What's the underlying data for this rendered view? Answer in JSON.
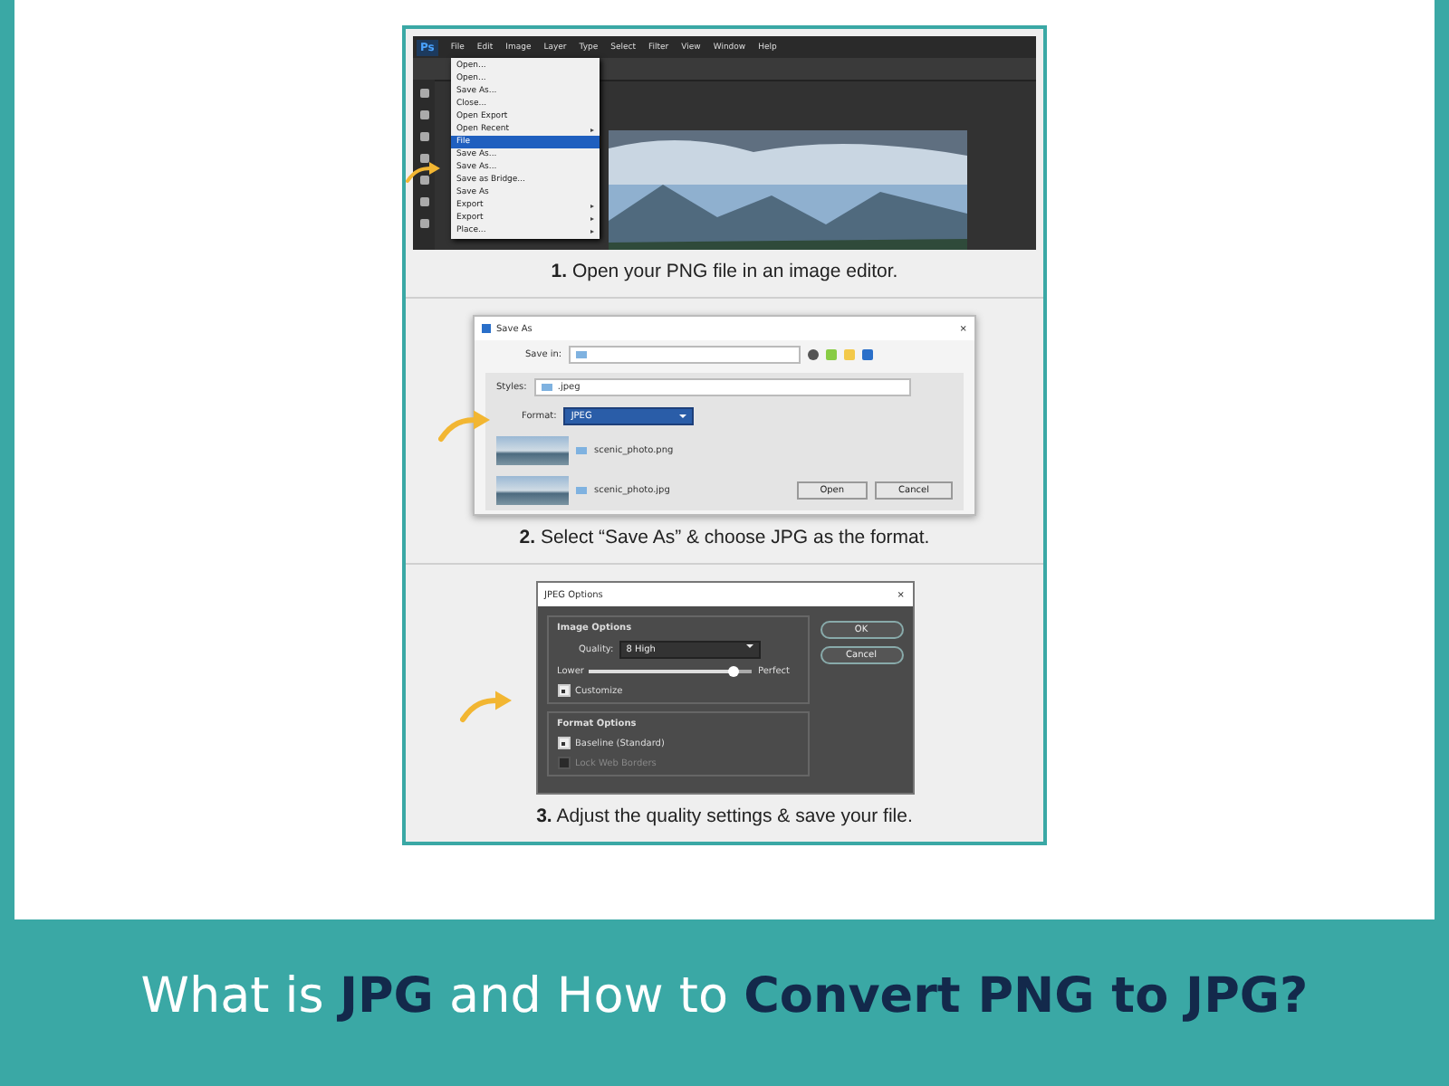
{
  "steps": [
    {
      "kind": "editor",
      "caption": "**1.** Open your PNG file in an image editor.",
      "app_logo": "Ps",
      "menu_bar": [
        "File",
        "Edit",
        "Image",
        "Layer",
        "Type",
        "Select",
        "Filter",
        "View",
        "Window",
        "Help"
      ],
      "menu_items": [
        {
          "label": "Open...",
          "selected": false,
          "submenu": false
        },
        {
          "label": "Open...",
          "selected": false,
          "submenu": false
        },
        {
          "label": "Save As...",
          "selected": false,
          "submenu": false
        },
        {
          "label": "Close...",
          "selected": false,
          "submenu": false
        },
        {
          "label": "Open Export",
          "selected": false,
          "submenu": false
        },
        {
          "label": "Open Recent",
          "selected": false,
          "submenu": true
        },
        {
          "label": "File",
          "selected": true,
          "submenu": false
        },
        {
          "label": "Save As...",
          "selected": false,
          "submenu": false
        },
        {
          "label": "Save As...",
          "selected": false,
          "submenu": false
        },
        {
          "label": "Save as Bridge...",
          "selected": false,
          "submenu": false
        },
        {
          "label": "Save As",
          "selected": false,
          "submenu": false
        },
        {
          "label": "Export",
          "selected": false,
          "submenu": true
        },
        {
          "label": "Export",
          "selected": false,
          "submenu": true
        },
        {
          "label": "Place...",
          "selected": false,
          "submenu": true
        }
      ]
    },
    {
      "kind": "save_dialog",
      "caption": "**2.** Select “Save As” & choose JPG as the format.",
      "title": "Save As",
      "close": "×",
      "save_in_label": "Save in:",
      "styles_label": "Styles:",
      "styles_value": ".jpeg",
      "format_label": "Format:",
      "format_value": "JPEG",
      "files": [
        {
          "name": "scenic_photo.png"
        },
        {
          "name": "scenic_photo.jpg"
        }
      ],
      "buttons": [
        "Open",
        "Cancel"
      ]
    },
    {
      "kind": "jpeg_options",
      "caption": "**3.** Adjust the quality settings & save your file.",
      "title": "JPEG Options",
      "close": "×",
      "image_options": "Image Options",
      "quality_label": "Quality:",
      "quality_number": "8",
      "quality_value": "High",
      "low_label": "Lower",
      "high_label": "Perfect",
      "level": 0.88,
      "format_options": "Format Options",
      "checks": [
        {
          "label": "Customize",
          "checked": true,
          "disabled": false
        },
        {
          "label": "Baseline (Standard)",
          "checked": true,
          "disabled": false
        },
        {
          "label": "Lock Web Borders",
          "checked": false,
          "disabled": true
        }
      ],
      "buttons": [
        "OK",
        "Cancel"
      ]
    }
  ],
  "banner": {
    "title": "What is **JPG** and How to **Convert PNG to JPG?**"
  }
}
